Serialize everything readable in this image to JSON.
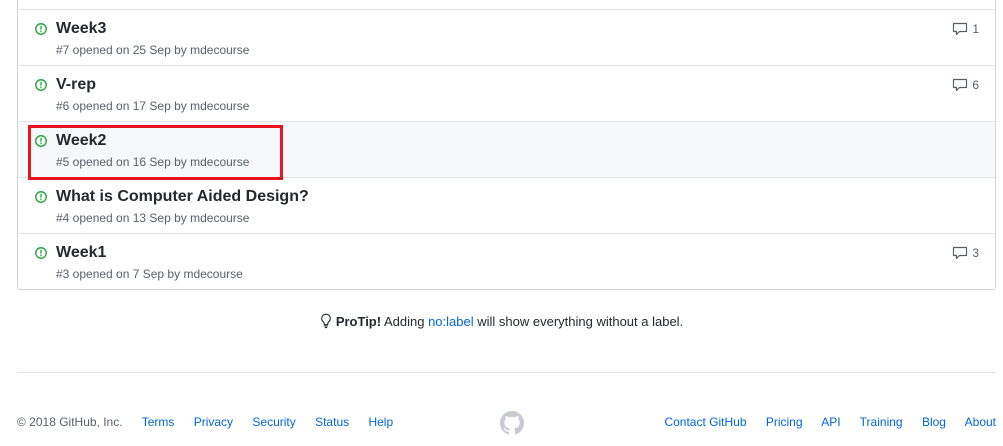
{
  "issues": [
    {
      "title": "Week3",
      "meta": "#7 opened on 25 Sep by mdecourse",
      "comments": "1"
    },
    {
      "title": "V-rep",
      "meta": "#6 opened on 17 Sep by mdecourse",
      "comments": "6"
    },
    {
      "title": "Week2",
      "meta": "#5 opened on 16 Sep by mdecourse",
      "comments": ""
    },
    {
      "title": "What is Computer Aided Design?",
      "meta": "#4 opened on 13 Sep by mdecourse",
      "comments": ""
    },
    {
      "title": "Week1",
      "meta": "#3 opened on 7 Sep by mdecourse",
      "comments": "3"
    }
  ],
  "protip": {
    "label": "ProTip!",
    "before": " Adding ",
    "link": "no:label",
    "after": " will show everything without a label."
  },
  "footer": {
    "copyright": "© 2018 GitHub, Inc.",
    "left_links": [
      "Terms",
      "Privacy",
      "Security",
      "Status",
      "Help"
    ],
    "right_links": [
      "Contact GitHub",
      "Pricing",
      "API",
      "Training",
      "Blog",
      "About"
    ]
  },
  "icons": {
    "issue_open": "issue-opened-icon",
    "comment": "comment-icon",
    "protip": "light-bulb-icon",
    "logo": "github-mark-icon"
  },
  "colors": {
    "open_issue": "#28a745",
    "link": "#0366d6",
    "highlight": "#e8141f"
  }
}
